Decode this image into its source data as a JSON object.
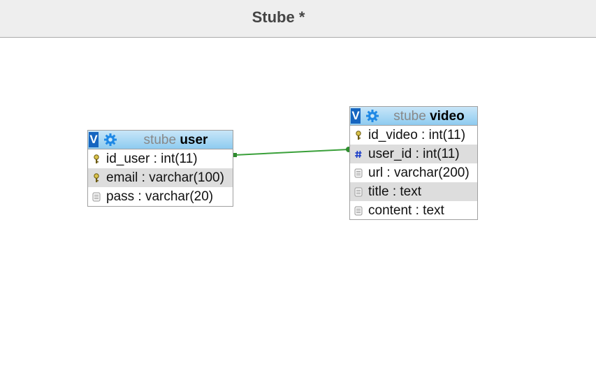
{
  "window": {
    "title": "Stube *"
  },
  "colors": {
    "header_gradient_top": "#c8e6f8",
    "header_gradient_bottom": "#8ecbf0",
    "relation_line": "#3aa03a",
    "v_button": "#1565c0",
    "gear": "#1e88e5",
    "shaded_row": "#dddddd"
  },
  "tables": {
    "user": {
      "database": "stube",
      "name": "user",
      "v_label": "V",
      "columns": [
        {
          "text": "id_user : int(11)",
          "icon": "key-icon"
        },
        {
          "text": "email : varchar(100)",
          "icon": "key-icon"
        },
        {
          "text": "pass : varchar(20)",
          "icon": "text-field-icon"
        }
      ]
    },
    "video": {
      "database": "stube",
      "name": "video",
      "v_label": "V",
      "columns": [
        {
          "text": "id_video : int(11)",
          "icon": "key-icon"
        },
        {
          "text": "user_id : int(11)",
          "icon": "hash-icon"
        },
        {
          "text": "url : varchar(200)",
          "icon": "text-field-icon"
        },
        {
          "text": "title : text",
          "icon": "text-field-icon"
        },
        {
          "text": "content : text",
          "icon": "text-field-icon"
        }
      ]
    }
  },
  "relations": [
    {
      "from": "user.id_user",
      "to": "video.user_id"
    }
  ]
}
